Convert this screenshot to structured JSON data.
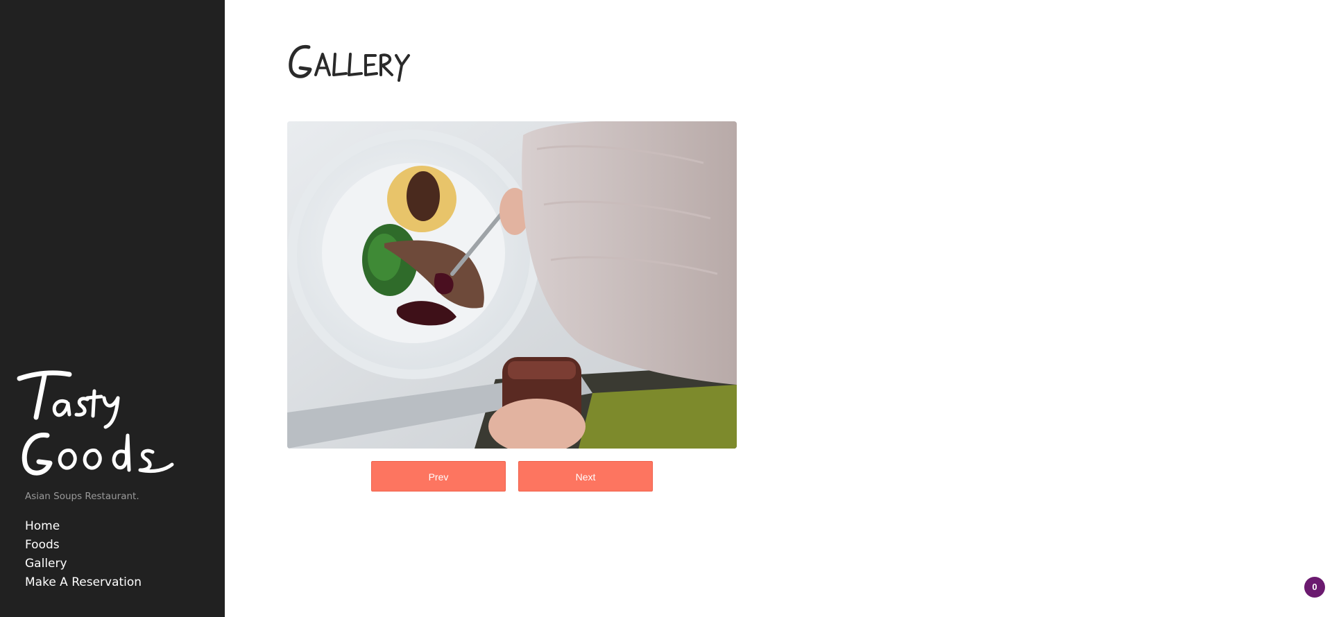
{
  "brand": {
    "name_line1": "Tasty",
    "name_line2": "Goods",
    "tagline": "Asian Soups Restaurant."
  },
  "nav": {
    "items": [
      {
        "label": "Home"
      },
      {
        "label": "Foods"
      },
      {
        "label": "Gallery"
      },
      {
        "label": "Make A Reservation"
      }
    ]
  },
  "page": {
    "title": "Gallery"
  },
  "gallery": {
    "prev_label": "Prev",
    "next_label": "Next"
  },
  "notification": {
    "count": "0"
  },
  "colors": {
    "sidebar_bg": "#212121",
    "accent": "#fd7560",
    "badge": "#6b1a6f"
  }
}
